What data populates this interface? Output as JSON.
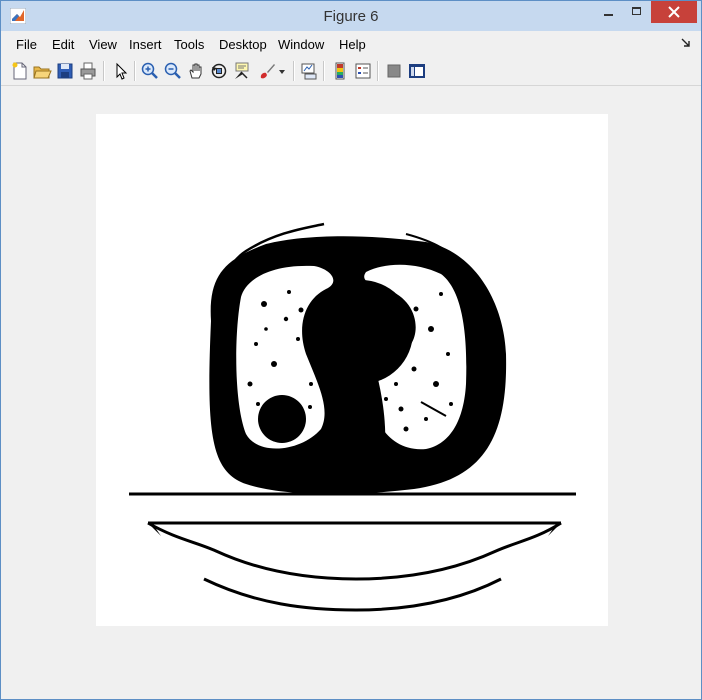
{
  "window": {
    "title": "Figure 6"
  },
  "menu": {
    "file": "File",
    "edit": "Edit",
    "view": "View",
    "insert": "Insert",
    "tools": "Tools",
    "desktop": "Desktop",
    "window": "Window",
    "help": "Help"
  },
  "toolbar": {
    "buttons": [
      "new-figure",
      "open-file",
      "save-figure",
      "print-figure",
      "edit-plot",
      "zoom-in",
      "zoom-out",
      "pan",
      "rotate-3d",
      "data-cursor",
      "brush",
      "link-plot",
      "insert-colorbar",
      "insert-legend",
      "hide-plot-tools",
      "show-plot-tools"
    ]
  },
  "figure": {
    "content": "binary-threshold-ct-slice"
  }
}
